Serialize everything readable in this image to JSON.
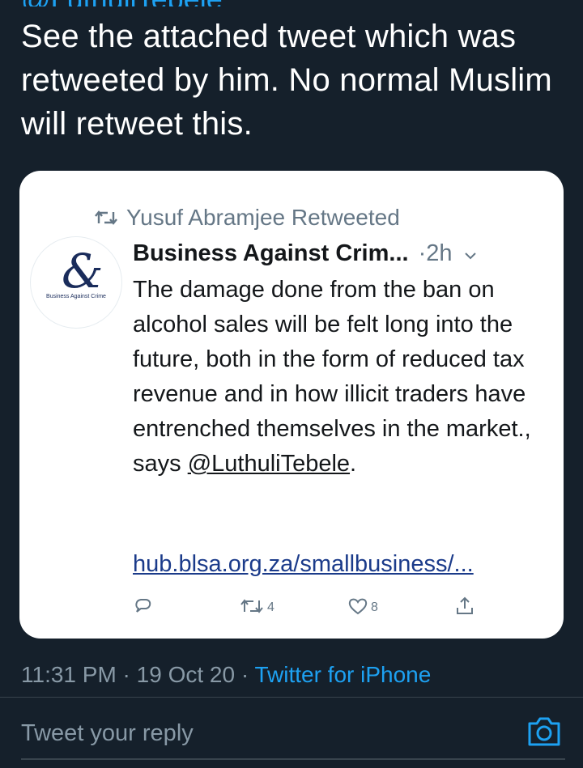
{
  "tweet": {
    "top_partial": "@LuthuliTebele",
    "text": "See the attached tweet which was retweeted by him. No normal Muslim will retweet this.",
    "meta_time": "11:31 PM · 19 Oct 20 · ",
    "meta_source": "Twitter for iPhone"
  },
  "quoted": {
    "retweeted_by": "Yusuf Abramjee Retweeted",
    "avatar_org": "Business Against Crime",
    "name": "Business Against Crim...",
    "time": "·2h",
    "body": "The damage done from the ban on alcohol sales will be felt long into the future, both in the form of reduced tax revenue and in how illicit traders have entrenched themselves in the market., says ",
    "mention": "@LuthuliTebele",
    "after_mention": ".",
    "link": "hub.blsa.org.za/smallbusiness/...",
    "retweets": "4",
    "likes": "8"
  },
  "reply": {
    "placeholder": "Tweet your reply"
  },
  "icons": {
    "retweet": "retweet-icon",
    "reply": "reply-icon",
    "like": "heart-icon",
    "share": "share-icon",
    "camera": "camera-icon",
    "menu": "chevron-down-icon"
  },
  "colors": {
    "background": "#15202b",
    "accent": "#1da1f2",
    "card": "#ffffff",
    "muted": "#8899a6"
  }
}
